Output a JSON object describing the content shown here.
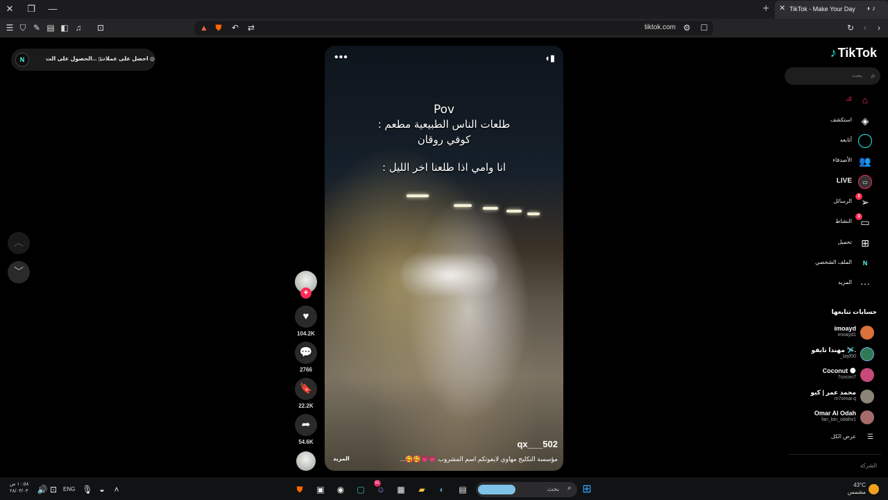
{
  "tab": {
    "title": "TikTok - Make Your Day"
  },
  "address": {
    "url": "tiktok.com"
  },
  "promo": {
    "item1": "احصل على عملات",
    "item2": "الحصول على الت..."
  },
  "video": {
    "overlay_title": "Pov",
    "overlay_line1": "طلعات الناس الطبيعية مطعم :",
    "overlay_line2": "كوفي روقان",
    "overlay_line3": "انا وامي اذا طلعنا اخر الليل :",
    "username": "qx___502",
    "caption": "مؤسسة التكليج مهاوي لايفوتكم اسم المشروب 💗💗🥰🥰...",
    "more_label": "المزيد"
  },
  "actions": {
    "likes": "104.2K",
    "comments": "2766",
    "saves": "22.2K",
    "shares": "54.6K"
  },
  "sidebar": {
    "logo": "TikTok",
    "search_placeholder": "بحث",
    "nav": [
      {
        "label": "لك"
      },
      {
        "label": "استكشف"
      },
      {
        "label": "أتابعه"
      },
      {
        "label": "الأصدقاء"
      },
      {
        "label": "LIVE"
      },
      {
        "label": "الرسائل",
        "badge": "2"
      },
      {
        "label": "النشاط",
        "badge": "3"
      },
      {
        "label": "تحميل"
      },
      {
        "label": "الملف الشخصي"
      },
      {
        "label": "المزيد"
      }
    ],
    "following_title": "حسابات تتابعها",
    "accounts": [
      {
        "name": "imoayd",
        "handle": "imoayd1"
      },
      {
        "name": "مهندا تايفو 🛩️.",
        "handle": "_tayf00"
      },
      {
        "name": "Coconut 🌑",
        "handle": "7cocon7"
      },
      {
        "name": "محمد عمر | كيو",
        "handle": "m7omar.q"
      },
      {
        "name": "Omar Al Odah",
        "handle": "fan_bin_odahx1"
      }
    ],
    "see_all": "عرض الكل",
    "company": "الشركة"
  },
  "taskbar": {
    "time": "١٠:٥٨ ص",
    "date": "٢٨/٠٣/٠٣",
    "lang": "ENG",
    "search_placeholder": "بحث",
    "temp": "43°C",
    "condition": "مشمس",
    "badge_discord": "91"
  },
  "colors": {
    "accent": "#fe2c55",
    "cyan": "#25f4ee"
  }
}
